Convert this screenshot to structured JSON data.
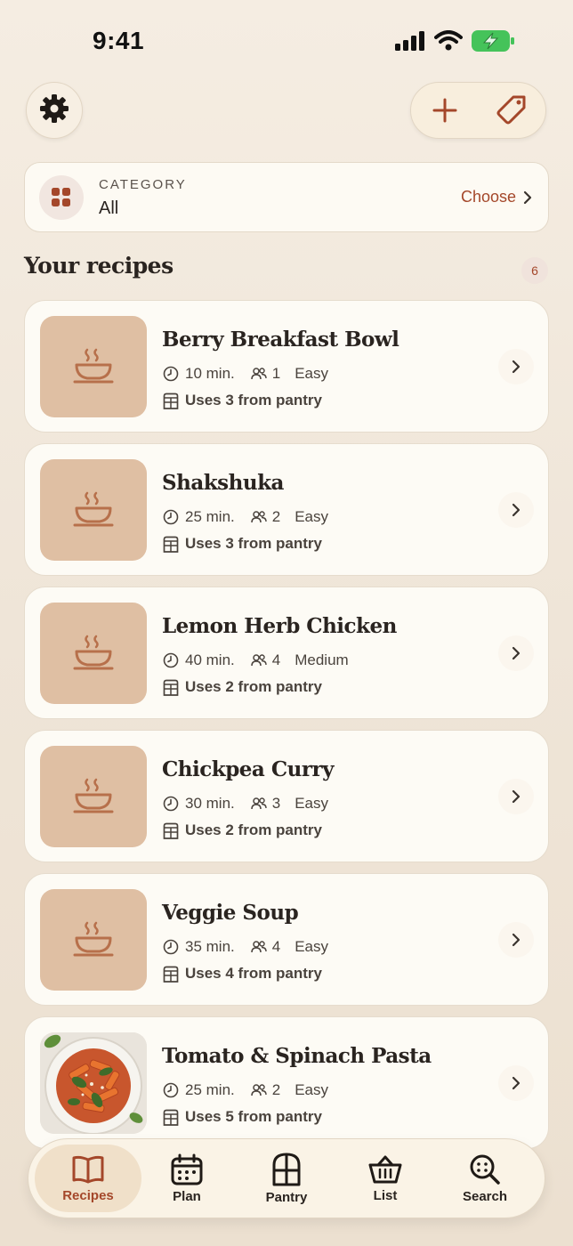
{
  "status_bar": {
    "time": "9:41"
  },
  "header": {
    "settings_icon": "gear-icon",
    "add_icon": "plus-icon",
    "tag_icon": "tag-icon"
  },
  "category": {
    "label": "CATEGORY",
    "value": "All",
    "choose": "Choose"
  },
  "section": {
    "title": "Your recipes",
    "count": "6"
  },
  "recipes": [
    {
      "name": "Berry Breakfast Bowl",
      "time": "10 min.",
      "servings": "1",
      "difficulty": "Easy",
      "pantry": "Uses 3 from pantry"
    },
    {
      "name": "Shakshuka",
      "time": "25 min.",
      "servings": "2",
      "difficulty": "Easy",
      "pantry": "Uses 3 from pantry"
    },
    {
      "name": "Lemon Herb Chicken",
      "time": "40 min.",
      "servings": "4",
      "difficulty": "Medium",
      "pantry": "Uses 2 from pantry"
    },
    {
      "name": "Chickpea Curry",
      "time": "30 min.",
      "servings": "3",
      "difficulty": "Easy",
      "pantry": "Uses 2 from pantry"
    },
    {
      "name": "Veggie Soup",
      "time": "35 min.",
      "servings": "4",
      "difficulty": "Easy",
      "pantry": "Uses 4 from pantry"
    },
    {
      "name": "Tomato & Spinach Pasta",
      "time": "25 min.",
      "servings": "2",
      "difficulty": "Easy",
      "pantry": "Uses 5 from pantry"
    }
  ],
  "tabs": [
    {
      "label": "Recipes",
      "icon": "book-icon"
    },
    {
      "label": "Plan",
      "icon": "calendar-icon"
    },
    {
      "label": "Pantry",
      "icon": "pantry-icon"
    },
    {
      "label": "List",
      "icon": "basket-icon"
    },
    {
      "label": "Search",
      "icon": "search-icon"
    }
  ],
  "colors": {
    "accent": "#a4472a",
    "background": "#f5ede2",
    "card": "#fdfbf5",
    "thumb": "#dfbfa3"
  }
}
